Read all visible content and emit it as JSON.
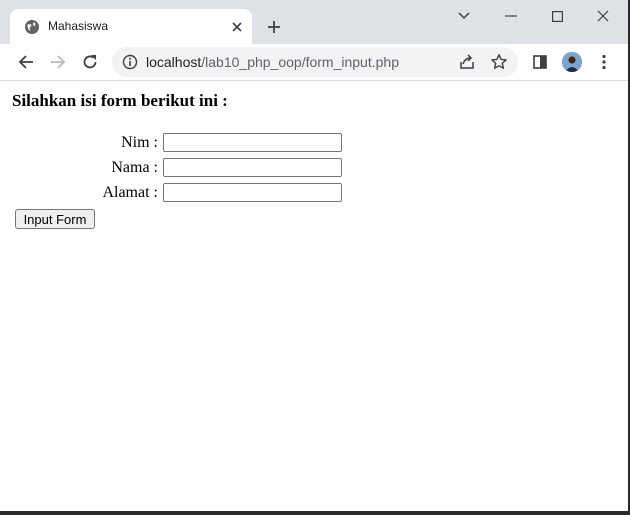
{
  "tab": {
    "title": "Mahasiswa"
  },
  "address_bar": {
    "host": "localhost",
    "path": "/lab10_php_oop/form_input.php"
  },
  "page": {
    "heading": "Silahkan isi form berikut ini :",
    "fields": [
      {
        "label": "Nim :",
        "value": ""
      },
      {
        "label": "Nama :",
        "value": ""
      },
      {
        "label": "Alamat :",
        "value": ""
      }
    ],
    "submit_label": "Input Form"
  },
  "icons": {
    "tab_favicon": "globe-icon",
    "tab_close": "close-icon",
    "new_tab": "plus-icon",
    "back": "back-arrow-icon",
    "forward": "forward-arrow-icon",
    "reload": "reload-icon",
    "site_info": "info-icon",
    "share": "share-icon",
    "bookmark": "star-icon",
    "side_panel": "side-panel-icon",
    "menu": "kebab-menu-icon"
  },
  "colors": {
    "tabstrip": "#dee1e6",
    "omnibox": "#f1f3f4",
    "accent": "#1a73e8"
  }
}
